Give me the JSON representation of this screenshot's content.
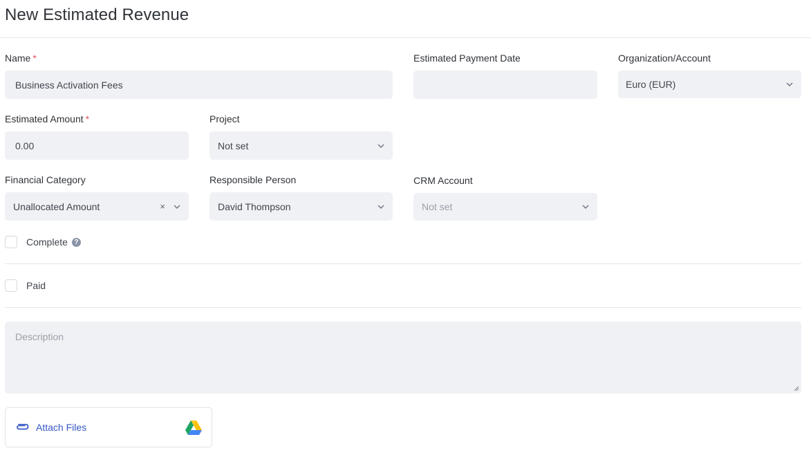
{
  "page": {
    "title": "New Estimated Revenue"
  },
  "form": {
    "name": {
      "label": "Name",
      "required_mark": "*",
      "value": "Business Activation Fees"
    },
    "payment_date": {
      "label": "Estimated Payment Date",
      "value": ""
    },
    "organization": {
      "label": "Organization/Account",
      "value": "Euro (EUR)"
    },
    "amount": {
      "label": "Estimated Amount",
      "required_mark": "*",
      "value": "0.00"
    },
    "project": {
      "label": "Project",
      "value": "Not set"
    },
    "financial_category": {
      "label": "Financial Category",
      "value": "Unallocated Amount",
      "clear_glyph": "×"
    },
    "responsible_person": {
      "label": "Responsible Person",
      "value": "David Thompson"
    },
    "crm_account": {
      "label": "CRM Account",
      "value": "Not set",
      "disabled": true
    },
    "complete": {
      "label": "Complete",
      "checked": false,
      "help_glyph": "?"
    },
    "paid": {
      "label": "Paid",
      "checked": false
    },
    "description": {
      "placeholder": "Description",
      "value": ""
    },
    "attachments": {
      "label": "Attach Files",
      "link_color": "#3557c7",
      "drive_icon": "google-drive-icon"
    }
  },
  "colors": {
    "field_bg": "#f0f1f5",
    "required": "#e2545b",
    "border": "#e3e5e8"
  }
}
